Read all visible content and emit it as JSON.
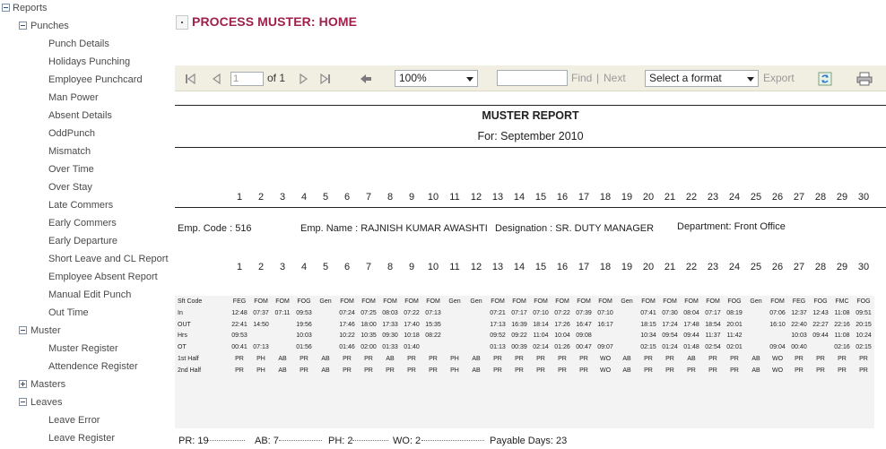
{
  "sidebar": {
    "items": [
      {
        "label": "Reports",
        "level": 0,
        "toggle": "minus"
      },
      {
        "label": "Punches",
        "level": 1,
        "toggle": "minus"
      },
      {
        "label": "Punch Details",
        "level": 2
      },
      {
        "label": "Holidays Punching",
        "level": 2
      },
      {
        "label": "Employee Punchcard",
        "level": 2
      },
      {
        "label": "Man Power",
        "level": 2
      },
      {
        "label": "Absent Details",
        "level": 2
      },
      {
        "label": "OddPunch",
        "level": 2
      },
      {
        "label": "Mismatch",
        "level": 2
      },
      {
        "label": "Over Time",
        "level": 2
      },
      {
        "label": "Over Stay",
        "level": 2
      },
      {
        "label": "Late Commers",
        "level": 2
      },
      {
        "label": "Early Commers",
        "level": 2
      },
      {
        "label": "Early Departure",
        "level": 2
      },
      {
        "label": "Short Leave and CL Report",
        "level": 2
      },
      {
        "label": "Employee Absent Report",
        "level": 2
      },
      {
        "label": "Manual Edit Punch",
        "level": 2
      },
      {
        "label": "Out Time",
        "level": 2
      },
      {
        "label": "Muster",
        "level": 1,
        "toggle": "minus"
      },
      {
        "label": "Muster Register",
        "level": 2
      },
      {
        "label": "Attendence Register",
        "level": 2
      },
      {
        "label": "Masters",
        "level": 1,
        "toggle": "plus"
      },
      {
        "label": "Leaves",
        "level": 1,
        "toggle": "minus"
      },
      {
        "label": "Leave Error",
        "level": 2
      },
      {
        "label": "Leave Register",
        "level": 2
      }
    ]
  },
  "page": {
    "title": "PROCESS MUSTER: HOME"
  },
  "toolbar": {
    "page_value": "1",
    "of_pages": "of 1",
    "zoom": "100%",
    "find_value": "",
    "find_label": "Find",
    "separator": "|",
    "next_label": "Next",
    "format_label": "Select a format",
    "export_label": "Export"
  },
  "report": {
    "title": "MUSTER REPORT",
    "subtitle": "For: September 2010",
    "days": [
      "1",
      "2",
      "3",
      "4",
      "5",
      "6",
      "7",
      "8",
      "9",
      "10",
      "11",
      "12",
      "13",
      "14",
      "15",
      "16",
      "17",
      "18",
      "19",
      "20",
      "21",
      "22",
      "23",
      "24",
      "25",
      "26",
      "27",
      "28",
      "29",
      "30"
    ],
    "employee": {
      "code": "Emp. Code : 516",
      "name": "Emp. Name : RAJNISH KUMAR AWASHTI",
      "designation": "Designation : SR. DUTY MANAGER",
      "department": "Department: Front Office"
    },
    "rows": [
      {
        "label": "Sft Code",
        "cells": [
          "FEG",
          "FOM",
          "FOM",
          "FOG",
          "Gen",
          "FOM",
          "FOM",
          "FOM",
          "FOM",
          "FOM",
          "Gen",
          "Gen",
          "FOM",
          "FOM",
          "FOM",
          "FOM",
          "FOM",
          "FOM",
          "Gen",
          "FOM",
          "FOM",
          "FOM",
          "FOM",
          "FOG",
          "Gen",
          "FOM",
          "FEG",
          "FOG",
          "FMC",
          "FOG"
        ]
      },
      {
        "label": "In",
        "cells": [
          "12:48",
          "07:37",
          "07:11",
          "09:53",
          "",
          "07:24",
          "07:25",
          "08:03",
          "07:22",
          "07:13",
          "",
          "",
          "07:21",
          "07:17",
          "07:10",
          "07:22",
          "07:39",
          "07:10",
          "",
          "07:41",
          "07:30",
          "08:04",
          "07:17",
          "08:19",
          "",
          "07:06",
          "12:37",
          "12:43",
          "11:08",
          "09:51"
        ]
      },
      {
        "label": "OUT",
        "cells": [
          "22:41",
          "14:50",
          "",
          "19:56",
          "",
          "17:46",
          "18:00",
          "17:33",
          "17:40",
          "15:35",
          "",
          "",
          "17:13",
          "16:39",
          "18:14",
          "17:26",
          "16:47",
          "16:17",
          "",
          "18:15",
          "17:24",
          "17:48",
          "18:54",
          "20:01",
          "",
          "16:10",
          "22:40",
          "22:27",
          "22:16",
          "20:15"
        ]
      },
      {
        "label": "Hrs",
        "cells": [
          "09:53",
          "",
          "",
          "10:03",
          "",
          "10:22",
          "10:35",
          "09:30",
          "10:18",
          "08:22",
          "",
          "",
          "09:52",
          "09:22",
          "11:04",
          "10:04",
          "09:08",
          "",
          "",
          "10:34",
          "09:54",
          "09:44",
          "11:37",
          "11:42",
          "",
          "",
          "10:03",
          "09:44",
          "11:08",
          "10:24"
        ]
      },
      {
        "label": "OT",
        "cells": [
          "00:41",
          "07:13",
          "",
          "01:56",
          "",
          "01:46",
          "02:00",
          "01:33",
          "01:40",
          "",
          "",
          "",
          "01:13",
          "00:39",
          "02:14",
          "01:26",
          "00:47",
          "09:07",
          "",
          "02:15",
          "01:24",
          "01:48",
          "02:54",
          "02:01",
          "",
          "09:04",
          "00:40",
          "",
          "02:16",
          "02:15"
        ]
      },
      {
        "label": "1st Half",
        "cells": [
          "PR",
          "PH",
          "AB",
          "PR",
          "AB",
          "PR",
          "PR",
          "AB",
          "PR",
          "PR",
          "PH",
          "AB",
          "PR",
          "PR",
          "PR",
          "PR",
          "PR",
          "WO",
          "AB",
          "PR",
          "PR",
          "AB",
          "PR",
          "PR",
          "AB",
          "WO",
          "PR",
          "PR",
          "PR",
          "PR"
        ]
      },
      {
        "label": "2nd Half",
        "cells": [
          "PR",
          "PH",
          "AB",
          "PR",
          "AB",
          "PR",
          "PR",
          "PR",
          "PR",
          "PR",
          "PH",
          "AB",
          "PR",
          "PR",
          "PR",
          "PR",
          "PR",
          "WO",
          "AB",
          "PR",
          "PR",
          "PR",
          "PR",
          "PR",
          "AB",
          "WO",
          "PR",
          "PR",
          "PR",
          "PR"
        ]
      }
    ],
    "summary": {
      "pr": "PR: 19",
      "ab": "AB: 7",
      "ph": "PH: 2",
      "wo": "WO: 2",
      "payable": "Payable Days: 23"
    }
  }
}
